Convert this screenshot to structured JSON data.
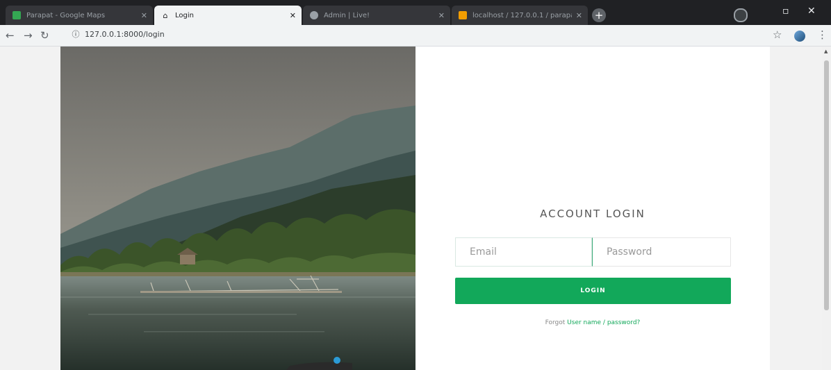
{
  "tabs": [
    {
      "title": "Parapat - Google Maps",
      "favicon": "maps-icon",
      "active": false
    },
    {
      "title": "Login",
      "favicon": "home-icon",
      "active": true
    },
    {
      "title": "Admin | Live!",
      "favicon": "globe-icon",
      "active": false
    },
    {
      "title": "localhost / 127.0.0.1 / parapat / ...",
      "favicon": "phpmyadmin-icon",
      "active": false
    }
  ],
  "address_bar": {
    "url": "127.0.0.1:8000/login"
  },
  "login": {
    "title": "ACCOUNT LOGIN",
    "email_placeholder": "Email",
    "password_placeholder": "Password",
    "button_label": "LOGIN",
    "forgot_prefix": "Forgot",
    "forgot_link": "User name / password?"
  },
  "colors": {
    "accent": "#12a85a",
    "chrome_dark": "#202124"
  }
}
